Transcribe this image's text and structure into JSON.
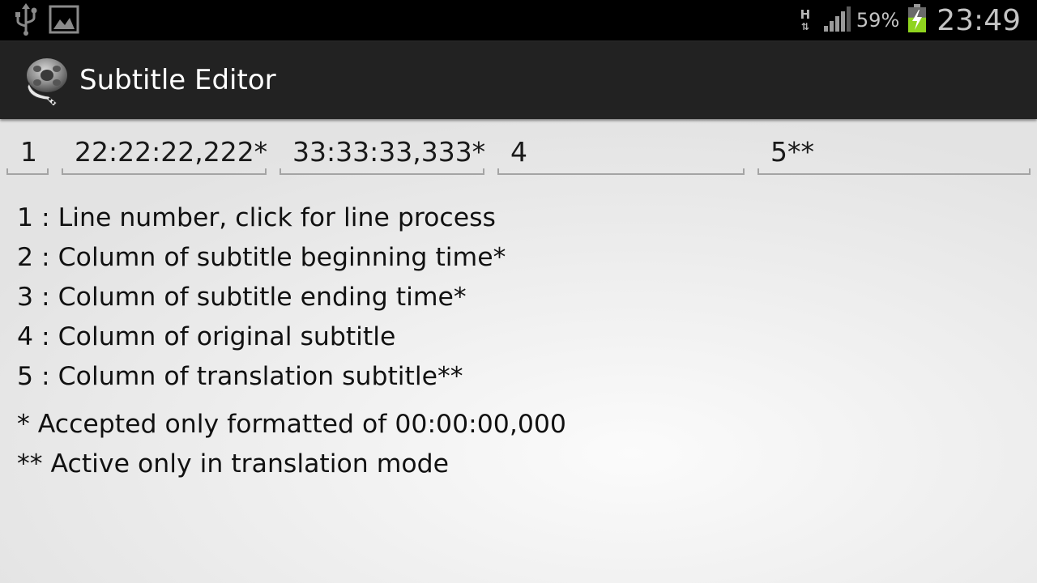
{
  "status_bar": {
    "left_icons": [
      "usb-icon",
      "image-notification-icon"
    ],
    "network_type": "H",
    "signal_icon": "signal-strength-icon",
    "battery_percent": "59%",
    "battery_icon": "battery-charging-icon",
    "battery_level": 0.59,
    "time": "23:49"
  },
  "action_bar": {
    "app_icon": "film-reel-icon",
    "title": "Subtitle Editor"
  },
  "columns": [
    {
      "label": "1"
    },
    {
      "label": "22:22:22,222*"
    },
    {
      "label": "33:33:33,333*"
    },
    {
      "label": "4"
    },
    {
      "label": "5**"
    }
  ],
  "legend": {
    "lines": [
      "1 : Line number, click for line process",
      "2 : Column of subtitle beginning time*",
      "3 : Column of subtitle ending time*",
      "4 : Column of original subtitle",
      "5 : Column of translation subtitle**"
    ],
    "notes": [
      "* Accepted only formatted of 00:00:00,000",
      "** Active only in translation mode"
    ]
  },
  "colors": {
    "status_bar_bg": "#000000",
    "action_bar_bg": "#222222",
    "battery_fill": "#8fd41e",
    "underline": "#a4a4a4"
  }
}
